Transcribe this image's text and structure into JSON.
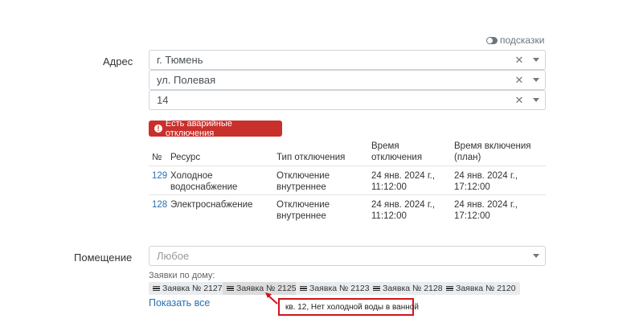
{
  "hints": {
    "label": "подсказки"
  },
  "address": {
    "label": "Адрес",
    "city": "г. Тюмень",
    "street": "ул. Полевая",
    "house": "14"
  },
  "alert": {
    "label": "Есть аварийные отключения",
    "color": "#c9302c"
  },
  "outages": {
    "headers": {
      "num": "№",
      "resource": "Ресурс",
      "type": "Тип отключения",
      "off_time": "Время отключения",
      "on_time": "Время включения (план)"
    },
    "rows": [
      {
        "num": "129",
        "resource": "Холодное водоснабжение",
        "type": "Отключение внутреннее",
        "off_time": "24 янв. 2024 г., 11:12:00",
        "on_time": "24 янв. 2024 г., 17:12:00"
      },
      {
        "num": "128",
        "resource": "Электроснабжение",
        "type": "Отключение внутреннее",
        "off_time": "24 янв. 2024 г., 11:12:00",
        "on_time": "24 янв. 2024 г., 17:12:00"
      }
    ]
  },
  "room": {
    "label": "Помещение",
    "placeholder": "Любое"
  },
  "requests": {
    "label": "Заявки по дому:",
    "tags": [
      "Заявка № 2127",
      "Заявка № 2125",
      "Заявка № 2123",
      "Заявка № 2128",
      "Заявка № 2120"
    ],
    "show_all": "Показать все",
    "tooltip": "кв. 12, Нет холодной воды в ванной"
  }
}
